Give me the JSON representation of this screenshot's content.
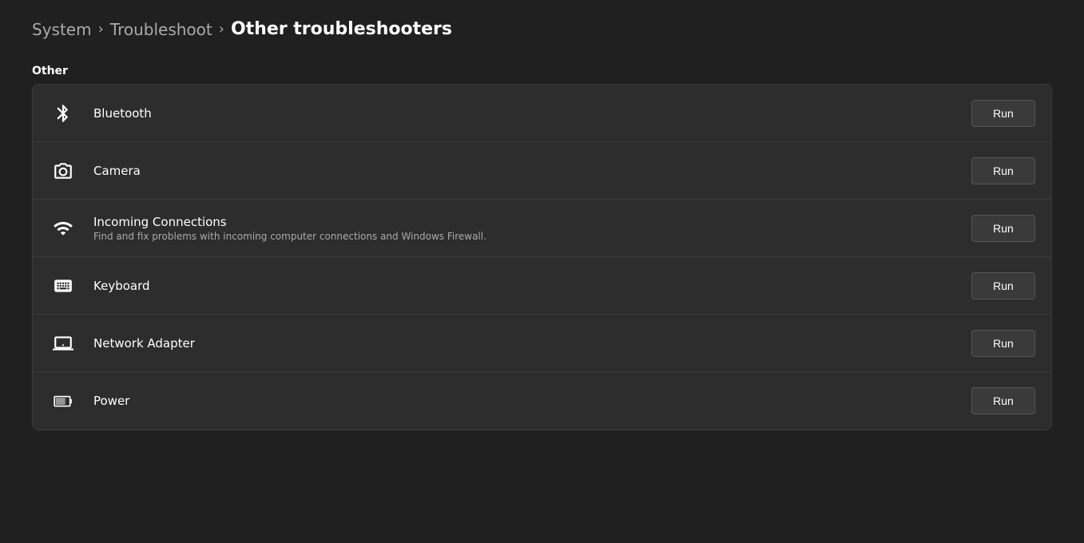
{
  "breadcrumb": {
    "items": [
      {
        "label": "System",
        "id": "system"
      },
      {
        "label": "Troubleshoot",
        "id": "troubleshoot"
      },
      {
        "label": "Other troubleshooters",
        "id": "other-troubleshooters",
        "current": true
      }
    ],
    "separator": "›"
  },
  "section": {
    "label": "Other"
  },
  "troubleshooters": [
    {
      "id": "bluetooth",
      "title": "Bluetooth",
      "description": "",
      "icon": "bluetooth",
      "run_label": "Run"
    },
    {
      "id": "camera",
      "title": "Camera",
      "description": "",
      "icon": "camera",
      "run_label": "Run"
    },
    {
      "id": "incoming-connections",
      "title": "Incoming Connections",
      "description": "Find and fix problems with incoming computer connections and Windows Firewall.",
      "icon": "connections",
      "run_label": "Run"
    },
    {
      "id": "keyboard",
      "title": "Keyboard",
      "description": "",
      "icon": "keyboard",
      "run_label": "Run"
    },
    {
      "id": "network-adapter",
      "title": "Network Adapter",
      "description": "",
      "icon": "network",
      "run_label": "Run"
    },
    {
      "id": "power",
      "title": "Power",
      "description": "",
      "icon": "power",
      "run_label": "Run"
    }
  ]
}
